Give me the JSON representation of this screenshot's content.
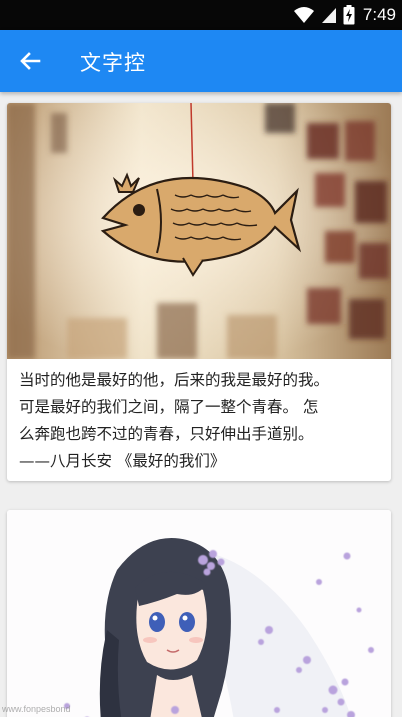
{
  "status_bar": {
    "time": "7:49",
    "icons": [
      "wifi-icon",
      "signal-icon",
      "battery-charging-icon"
    ]
  },
  "app_bar": {
    "back_icon": "arrow-left-icon",
    "title": "文字控"
  },
  "cards": [
    {
      "image": "fish-ornament-photo",
      "text_lines": [
        "当时的他是最好的他，后来的我是最好的我。",
        "可是最好的我们之间，隔了一整个青春。 怎",
        "么奔跑也跨不过的青春，只好伸出手道别。",
        "——八月长安 《最好的我们》"
      ]
    },
    {
      "image": "anime-bride-illustration"
    }
  ],
  "watermark": "www.fonpesbond"
}
